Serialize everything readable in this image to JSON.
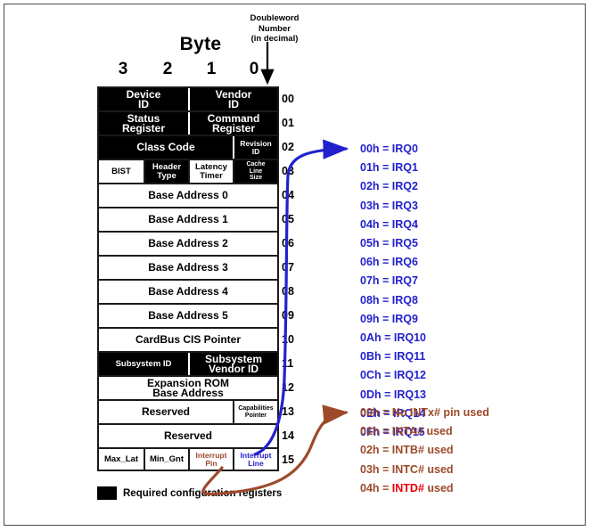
{
  "headers": {
    "byte_label": "Byte",
    "byte_numbers": [
      "3",
      "2",
      "1",
      "0"
    ],
    "doubleword_caption": "Doubleword\nNumber\n(in decimal)"
  },
  "table": {
    "doubleword_numbers": [
      "00",
      "01",
      "02",
      "03",
      "04",
      "05",
      "06",
      "07",
      "08",
      "09",
      "10",
      "11",
      "12",
      "13",
      "14",
      "15"
    ],
    "rows": [
      {
        "dw": "00",
        "cells": [
          {
            "label": "Device\nID",
            "style": "black",
            "span": 2
          },
          {
            "label": "Vendor\nID",
            "style": "black",
            "span": 2
          }
        ]
      },
      {
        "dw": "01",
        "cells": [
          {
            "label": "Status\nRegister",
            "style": "black",
            "span": 2
          },
          {
            "label": "Command\nRegister",
            "style": "black",
            "span": 2
          }
        ]
      },
      {
        "dw": "02",
        "cells": [
          {
            "label": "Class Code",
            "style": "black",
            "span": 3
          },
          {
            "label": "Revision\nID",
            "style": "black",
            "span": 1
          }
        ]
      },
      {
        "dw": "03",
        "cells": [
          {
            "label": "BIST",
            "style": "white",
            "span": 1
          },
          {
            "label": "Header\nType",
            "style": "black",
            "span": 1
          },
          {
            "label": "Latency\nTimer",
            "style": "white",
            "span": 1
          },
          {
            "label": "Cache\nLine\nSize",
            "style": "black",
            "span": 1
          }
        ]
      },
      {
        "dw": "04",
        "cells": [
          {
            "label": "Base Address 0",
            "style": "white",
            "span": 4
          }
        ]
      },
      {
        "dw": "05",
        "cells": [
          {
            "label": "Base Address 1",
            "style": "white",
            "span": 4
          }
        ]
      },
      {
        "dw": "06",
        "cells": [
          {
            "label": "Base Address 2",
            "style": "white",
            "span": 4
          }
        ]
      },
      {
        "dw": "07",
        "cells": [
          {
            "label": "Base Address 3",
            "style": "white",
            "span": 4
          }
        ]
      },
      {
        "dw": "08",
        "cells": [
          {
            "label": "Base Address 4",
            "style": "white",
            "span": 4
          }
        ]
      },
      {
        "dw": "09",
        "cells": [
          {
            "label": "Base Address 5",
            "style": "white",
            "span": 4
          }
        ]
      },
      {
        "dw": "10",
        "cells": [
          {
            "label": "CardBus CIS Pointer",
            "style": "white",
            "span": 4
          }
        ]
      },
      {
        "dw": "11",
        "cells": [
          {
            "label": "Subsystem ID",
            "style": "black",
            "span": 2
          },
          {
            "label": "Subsystem\nVendor ID",
            "style": "black",
            "span": 2
          }
        ]
      },
      {
        "dw": "12",
        "cells": [
          {
            "label": "Expansion ROM\nBase Address",
            "style": "white",
            "span": 4
          }
        ]
      },
      {
        "dw": "13",
        "cells": [
          {
            "label": "Reserved",
            "style": "white",
            "span": 3
          },
          {
            "label": "Capabilities\nPointer",
            "style": "white",
            "span": 1
          }
        ]
      },
      {
        "dw": "14",
        "cells": [
          {
            "label": "Reserved",
            "style": "white",
            "span": 4
          }
        ]
      },
      {
        "dw": "15",
        "cells": [
          {
            "label": "Max_Lat",
            "style": "white",
            "span": 1
          },
          {
            "label": "Min_Gnt",
            "style": "white",
            "span": 1
          },
          {
            "label": "Interrupt\nPin",
            "style": "white-orange",
            "span": 1
          },
          {
            "label": "Interrupt\nLine",
            "style": "white-blue",
            "span": 1
          }
        ]
      }
    ]
  },
  "legend": {
    "label": "Required configuration registers",
    "swatch_color": "#000000"
  },
  "interrupt_line_values": {
    "accent": "#2222cc",
    "entries": [
      "00h = IRQ0",
      "01h = IRQ1",
      "02h = IRQ2",
      "03h = IRQ3",
      "04h = IRQ4",
      "05h = IRQ5",
      "06h = IRQ6",
      "07h = IRQ7",
      "08h = IRQ8",
      "09h = IRQ9",
      "0Ah = IRQ10",
      "0Bh = IRQ11",
      "0Ch = IRQ12",
      "0Dh = IRQ13",
      "0Eh = IRQ14",
      "0Fh = IRQ15"
    ]
  },
  "interrupt_pin_values": {
    "accent": "#9c4a2a",
    "highlight": "#e8000a",
    "entries": [
      {
        "prefix": "00h = No INTx# pin used",
        "hot": "",
        "suffix": ""
      },
      {
        "prefix": "01h = INTA# used",
        "hot": "",
        "suffix": ""
      },
      {
        "prefix": "02h = INTB# used",
        "hot": "",
        "suffix": ""
      },
      {
        "prefix": "03h = INTC# used",
        "hot": "",
        "suffix": ""
      },
      {
        "prefix": "04h = ",
        "hot": "INTD#",
        "suffix": " used"
      }
    ]
  }
}
